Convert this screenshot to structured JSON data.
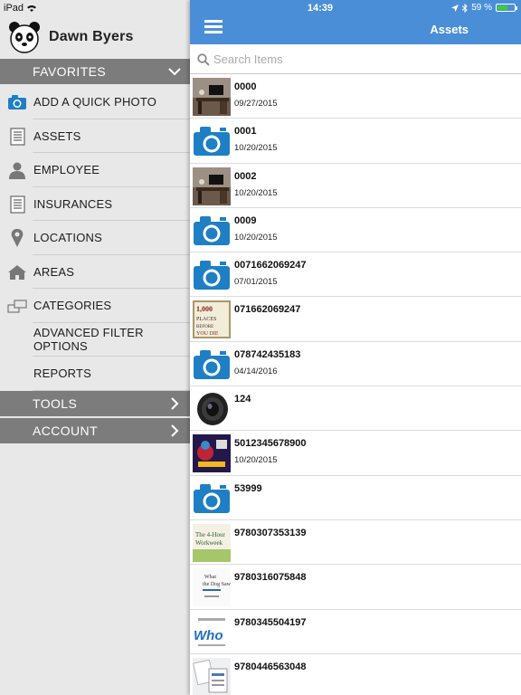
{
  "status": {
    "device": "iPad",
    "time": "14:39",
    "battery": "59 %",
    "battery_level": 0.59
  },
  "user": {
    "name": "Dawn Byers"
  },
  "sidebar": {
    "favorites_label": "FAVORITES",
    "items": [
      {
        "label": "ADD A QUICK PHOTO",
        "icon": "camera-icon"
      },
      {
        "label": "ASSETS",
        "icon": "document-icon"
      },
      {
        "label": "EMPLOYEE",
        "icon": "person-icon"
      },
      {
        "label": "INSURANCES",
        "icon": "document-icon"
      },
      {
        "label": "LOCATIONS",
        "icon": "map-pin-icon"
      },
      {
        "label": "AREAS",
        "icon": "house-icon"
      },
      {
        "label": "CATEGORIES",
        "icon": "categories-icon"
      },
      {
        "label": "ADVANCED FILTER OPTIONS",
        "icon": ""
      },
      {
        "label": "REPORTS",
        "icon": ""
      }
    ],
    "tools_label": "TOOLS",
    "account_label": "ACCOUNT"
  },
  "header": {
    "title": "Assets"
  },
  "search": {
    "placeholder": "Search Items"
  },
  "assets": [
    {
      "name": "0000",
      "date": "09/27/2015",
      "thumb": "desk-photo"
    },
    {
      "name": "0001",
      "date": "10/20/2015",
      "thumb": "camera-icon"
    },
    {
      "name": "0002",
      "date": "10/20/2015",
      "thumb": "desk-photo"
    },
    {
      "name": "0009",
      "date": "10/20/2015",
      "thumb": "camera-icon"
    },
    {
      "name": "0071662069247",
      "date": "07/01/2015",
      "thumb": "camera-icon"
    },
    {
      "name": "071662069247",
      "date": "",
      "thumb": "book-photo"
    },
    {
      "name": "078742435183",
      "date": "04/14/2016",
      "thumb": "camera-icon"
    },
    {
      "name": "124",
      "date": "",
      "thumb": "lens-photo"
    },
    {
      "name": "5012345678900",
      "date": "10/20/2015",
      "thumb": "dvd-photo"
    },
    {
      "name": "53999",
      "date": "",
      "thumb": "camera-icon"
    },
    {
      "name": "9780307353139",
      "date": "",
      "thumb": "book-green-photo"
    },
    {
      "name": "9780316075848",
      "date": "",
      "thumb": "book-white-photo"
    },
    {
      "name": "9780345504197",
      "date": "",
      "thumb": "book-who-photo"
    },
    {
      "name": "9780446563048",
      "date": "",
      "thumb": "book-papers-photo"
    }
  ],
  "colors": {
    "navbar": "#4a8ed8",
    "section_header": "#7c7c7c",
    "sidebar_bg": "#e8e8e8",
    "camera_blue": "#1f7fc4"
  }
}
